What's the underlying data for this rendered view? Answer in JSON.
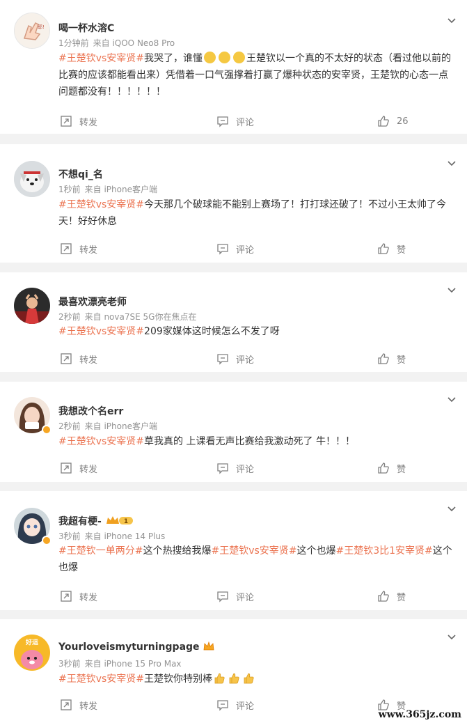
{
  "actions": {
    "repost": "转发",
    "comment": "评论",
    "like": "赞"
  },
  "topic": "#王楚钦vs安宰贤#",
  "posts": [
    {
      "name": "喝一杯水溶C",
      "time": "1分钟前",
      "source": "来自 iQOO Neo8 Pro",
      "t1": "我哭了，谁懂",
      "t2": "王楚钦以一个真的不太好的状态（看过他以前的比赛的应该都能看出来）凭借着一口气强撑着打赢了爆种状态的安宰贤，王楚钦的心态一点问题都没有！！！！！！",
      "likes": "26"
    },
    {
      "name": "不想qi_名",
      "time": "1秒前",
      "source": "来自 iPhone客户端",
      "t1": "今天那几个破球能不能别上赛场了！打打球还破了！不过小王太帅了今天！好好休息"
    },
    {
      "name": "最喜欢漂亮老师",
      "time": "2秒前",
      "source": "来自 nova7SE 5G你在焦点在",
      "t1": "209家媒体这时候怎么不发了呀"
    },
    {
      "name": "我想改个名err",
      "time": "2秒前",
      "source": "来自 iPhone客户端",
      "t1": "草我真的 上课看无声比赛给我激动死了 牛！！！"
    },
    {
      "name": "我超有梗-",
      "badge": "1",
      "time": "3秒前",
      "source": "来自 iPhone 14 Plus",
      "tag1": "#王楚钦一单两分#",
      "t1": "这个热搜给我爆",
      "t2": "这个也爆",
      "tag3": "#王楚钦3比1安宰贤#",
      "t3": "这个也爆"
    },
    {
      "name": "Yourloveismyturningpage",
      "avatar_text": "好运",
      "time": "3秒前",
      "source": "来自 iPhone 15 Pro Max",
      "t1": "王楚钦你特别棒"
    }
  ],
  "post1_avatar_text": "耶!",
  "watermark": "www.365jz.com",
  "colors": {
    "topic": "#eb7350",
    "meta": "#939393",
    "background": "#f2f2f2"
  }
}
